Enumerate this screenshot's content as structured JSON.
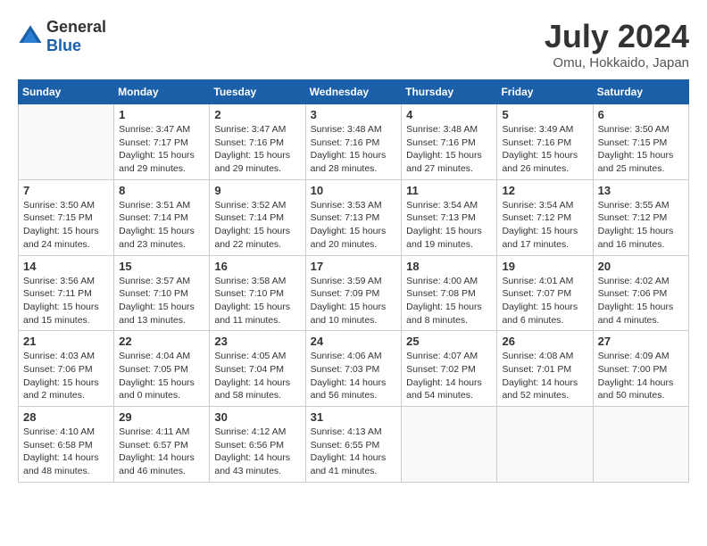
{
  "logo": {
    "general": "General",
    "blue": "Blue"
  },
  "title": "July 2024",
  "location": "Omu, Hokkaido, Japan",
  "weekdays": [
    "Sunday",
    "Monday",
    "Tuesday",
    "Wednesday",
    "Thursday",
    "Friday",
    "Saturday"
  ],
  "weeks": [
    [
      {
        "day": "",
        "content": ""
      },
      {
        "day": "1",
        "content": "Sunrise: 3:47 AM\nSunset: 7:17 PM\nDaylight: 15 hours\nand 29 minutes."
      },
      {
        "day": "2",
        "content": "Sunrise: 3:47 AM\nSunset: 7:16 PM\nDaylight: 15 hours\nand 29 minutes."
      },
      {
        "day": "3",
        "content": "Sunrise: 3:48 AM\nSunset: 7:16 PM\nDaylight: 15 hours\nand 28 minutes."
      },
      {
        "day": "4",
        "content": "Sunrise: 3:48 AM\nSunset: 7:16 PM\nDaylight: 15 hours\nand 27 minutes."
      },
      {
        "day": "5",
        "content": "Sunrise: 3:49 AM\nSunset: 7:16 PM\nDaylight: 15 hours\nand 26 minutes."
      },
      {
        "day": "6",
        "content": "Sunrise: 3:50 AM\nSunset: 7:15 PM\nDaylight: 15 hours\nand 25 minutes."
      }
    ],
    [
      {
        "day": "7",
        "content": "Sunrise: 3:50 AM\nSunset: 7:15 PM\nDaylight: 15 hours\nand 24 minutes."
      },
      {
        "day": "8",
        "content": "Sunrise: 3:51 AM\nSunset: 7:14 PM\nDaylight: 15 hours\nand 23 minutes."
      },
      {
        "day": "9",
        "content": "Sunrise: 3:52 AM\nSunset: 7:14 PM\nDaylight: 15 hours\nand 22 minutes."
      },
      {
        "day": "10",
        "content": "Sunrise: 3:53 AM\nSunset: 7:13 PM\nDaylight: 15 hours\nand 20 minutes."
      },
      {
        "day": "11",
        "content": "Sunrise: 3:54 AM\nSunset: 7:13 PM\nDaylight: 15 hours\nand 19 minutes."
      },
      {
        "day": "12",
        "content": "Sunrise: 3:54 AM\nSunset: 7:12 PM\nDaylight: 15 hours\nand 17 minutes."
      },
      {
        "day": "13",
        "content": "Sunrise: 3:55 AM\nSunset: 7:12 PM\nDaylight: 15 hours\nand 16 minutes."
      }
    ],
    [
      {
        "day": "14",
        "content": "Sunrise: 3:56 AM\nSunset: 7:11 PM\nDaylight: 15 hours\nand 15 minutes."
      },
      {
        "day": "15",
        "content": "Sunrise: 3:57 AM\nSunset: 7:10 PM\nDaylight: 15 hours\nand 13 minutes."
      },
      {
        "day": "16",
        "content": "Sunrise: 3:58 AM\nSunset: 7:10 PM\nDaylight: 15 hours\nand 11 minutes."
      },
      {
        "day": "17",
        "content": "Sunrise: 3:59 AM\nSunset: 7:09 PM\nDaylight: 15 hours\nand 10 minutes."
      },
      {
        "day": "18",
        "content": "Sunrise: 4:00 AM\nSunset: 7:08 PM\nDaylight: 15 hours\nand 8 minutes."
      },
      {
        "day": "19",
        "content": "Sunrise: 4:01 AM\nSunset: 7:07 PM\nDaylight: 15 hours\nand 6 minutes."
      },
      {
        "day": "20",
        "content": "Sunrise: 4:02 AM\nSunset: 7:06 PM\nDaylight: 15 hours\nand 4 minutes."
      }
    ],
    [
      {
        "day": "21",
        "content": "Sunrise: 4:03 AM\nSunset: 7:06 PM\nDaylight: 15 hours\nand 2 minutes."
      },
      {
        "day": "22",
        "content": "Sunrise: 4:04 AM\nSunset: 7:05 PM\nDaylight: 15 hours\nand 0 minutes."
      },
      {
        "day": "23",
        "content": "Sunrise: 4:05 AM\nSunset: 7:04 PM\nDaylight: 14 hours\nand 58 minutes."
      },
      {
        "day": "24",
        "content": "Sunrise: 4:06 AM\nSunset: 7:03 PM\nDaylight: 14 hours\nand 56 minutes."
      },
      {
        "day": "25",
        "content": "Sunrise: 4:07 AM\nSunset: 7:02 PM\nDaylight: 14 hours\nand 54 minutes."
      },
      {
        "day": "26",
        "content": "Sunrise: 4:08 AM\nSunset: 7:01 PM\nDaylight: 14 hours\nand 52 minutes."
      },
      {
        "day": "27",
        "content": "Sunrise: 4:09 AM\nSunset: 7:00 PM\nDaylight: 14 hours\nand 50 minutes."
      }
    ],
    [
      {
        "day": "28",
        "content": "Sunrise: 4:10 AM\nSunset: 6:58 PM\nDaylight: 14 hours\nand 48 minutes."
      },
      {
        "day": "29",
        "content": "Sunrise: 4:11 AM\nSunset: 6:57 PM\nDaylight: 14 hours\nand 46 minutes."
      },
      {
        "day": "30",
        "content": "Sunrise: 4:12 AM\nSunset: 6:56 PM\nDaylight: 14 hours\nand 43 minutes."
      },
      {
        "day": "31",
        "content": "Sunrise: 4:13 AM\nSunset: 6:55 PM\nDaylight: 14 hours\nand 41 minutes."
      },
      {
        "day": "",
        "content": ""
      },
      {
        "day": "",
        "content": ""
      },
      {
        "day": "",
        "content": ""
      }
    ]
  ]
}
